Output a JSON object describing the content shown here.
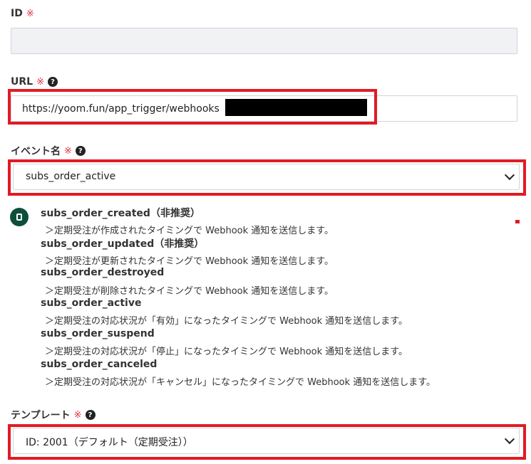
{
  "fields": {
    "id": {
      "label": "ID",
      "required_mark": "※",
      "value": ""
    },
    "url": {
      "label": "URL",
      "required_mark": "※",
      "help": "?",
      "value": "https://yoom.fun/app_trigger/webhooks"
    },
    "event": {
      "label": "イベント名",
      "required_mark": "※",
      "help": "?",
      "selected": "subs_order_active"
    },
    "template": {
      "label": "テンプレート",
      "required_mark": "※",
      "help": "?",
      "selected": "ID: 2001（デフォルト（定期受注））"
    }
  },
  "event_list": [
    {
      "name": "subs_order_created（非推奨）",
      "desc": "＞定期受注が作成されたタイミングで Webhook 通知を送信します。"
    },
    {
      "name": "subs_order_updated（非推奨）",
      "desc": "＞定期受注が更新されたタイミングで Webhook 通知を送信します。"
    },
    {
      "name": "subs_order_destroyed",
      "desc": "＞定期受注が削除されたタイミングで Webhook 通知を送信します。"
    },
    {
      "name": "subs_order_active",
      "desc": "＞定期受注の対応状況が「有効」になったタイミングで Webhook 通知を送信します。"
    },
    {
      "name": "subs_order_suspend",
      "desc": "＞定期受注の対応状況が「停止」になったタイミングで Webhook 通知を送信します。"
    },
    {
      "name": "subs_order_canceled",
      "desc": "＞定期受注の対応状況が「キャンセル」になったタイミングで Webhook 通知を送信します。"
    }
  ],
  "icons": {
    "help": "question-circle-icon",
    "app": "app-logo-icon",
    "chevron": "chevron-down-icon"
  },
  "colors": {
    "highlight": "#e01b24",
    "app_icon_bg": "#0e4f3b",
    "required": "#e0303a"
  }
}
